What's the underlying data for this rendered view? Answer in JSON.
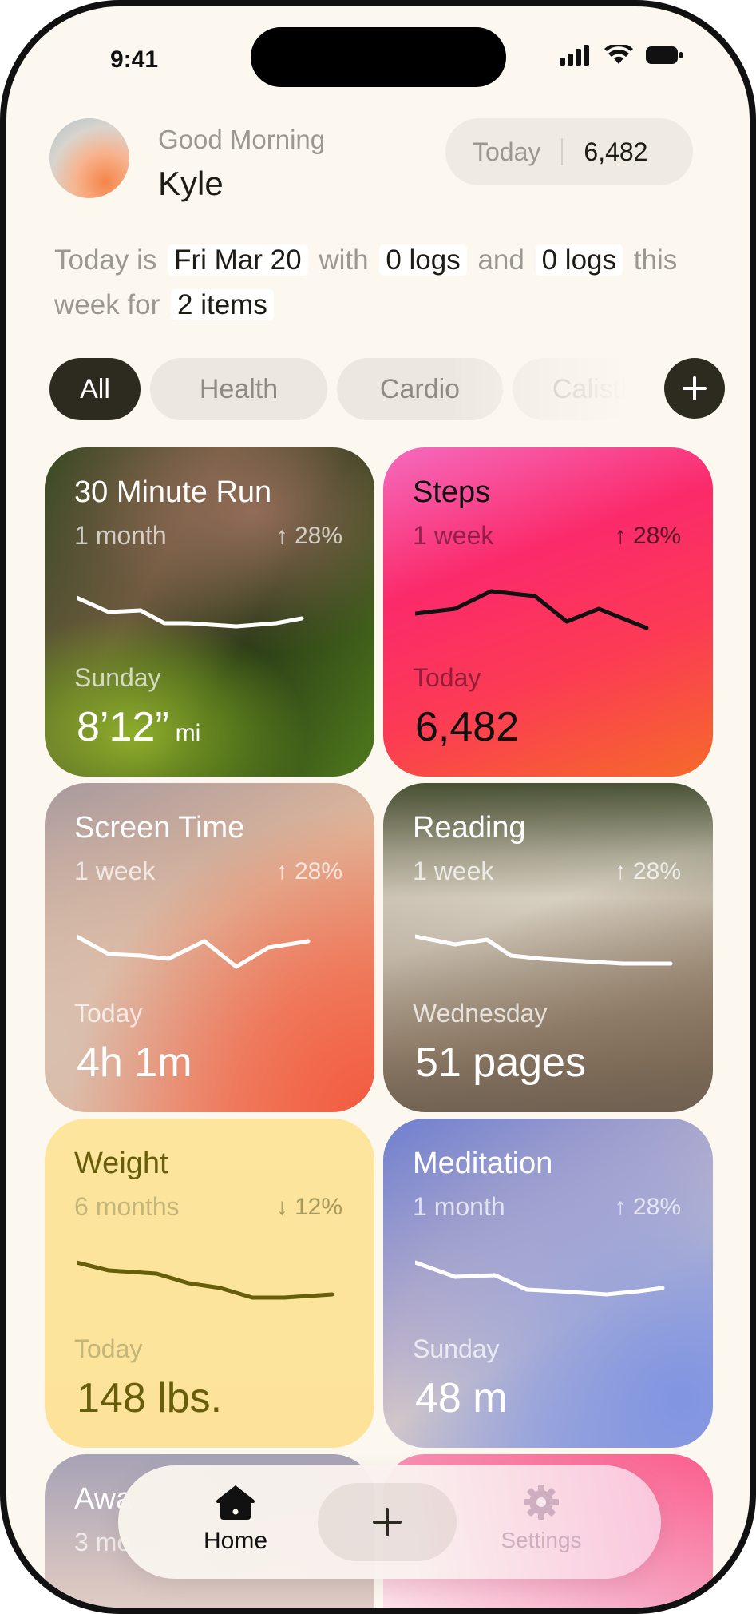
{
  "status_bar": {
    "time": "9:41"
  },
  "header": {
    "greeting": "Good Morning",
    "user_name": "Kyle",
    "today_label": "Today",
    "today_value": "6,482"
  },
  "summary": {
    "prefix": "Today is",
    "date": "Fri Mar 20",
    "with": "with",
    "logs_today": "0 logs",
    "and": "and",
    "logs_week": "0 logs",
    "this_week_for": "this week for",
    "items": "2 items"
  },
  "filters": {
    "chips": [
      "All",
      "Health",
      "Cardio",
      "Calisthenics"
    ],
    "active": "All",
    "add_icon": "plus-icon"
  },
  "cards": [
    {
      "title": "30 Minute Run",
      "period": "1 month",
      "change": "↑ 28%",
      "day_label": "Sunday",
      "value": "8’12”",
      "unit": "mi"
    },
    {
      "title": "Steps",
      "period": "1 week",
      "change": "↑ 28%",
      "day_label": "Today",
      "value": "6,482",
      "unit": ""
    },
    {
      "title": "Screen Time",
      "period": "1 week",
      "change": "↑ 28%",
      "day_label": "Today",
      "value": "4h 1m",
      "unit": ""
    },
    {
      "title": "Reading",
      "period": "1 week",
      "change": "↑ 28%",
      "day_label": "Wednesday",
      "value": "51 pages",
      "unit": ""
    },
    {
      "title": "Weight",
      "period": "6 months",
      "change": "↓ 12%",
      "day_label": "Today",
      "value": "148 lbs.",
      "unit": ""
    },
    {
      "title": "Meditation",
      "period": "1 month",
      "change": "↑ 28%",
      "day_label": "Sunday",
      "value": "48 m",
      "unit": ""
    },
    {
      "title": "Awa",
      "period": "3 mo"
    }
  ],
  "tabbar": {
    "home_label": "Home",
    "home_icon": "home-icon",
    "add_icon": "plus-icon",
    "settings_label": "Settings",
    "settings_icon": "gear-icon"
  },
  "colors": {
    "background": "#fcf8ef",
    "chip_active": "#2d2a1f",
    "weight_text": "#665e0a"
  }
}
